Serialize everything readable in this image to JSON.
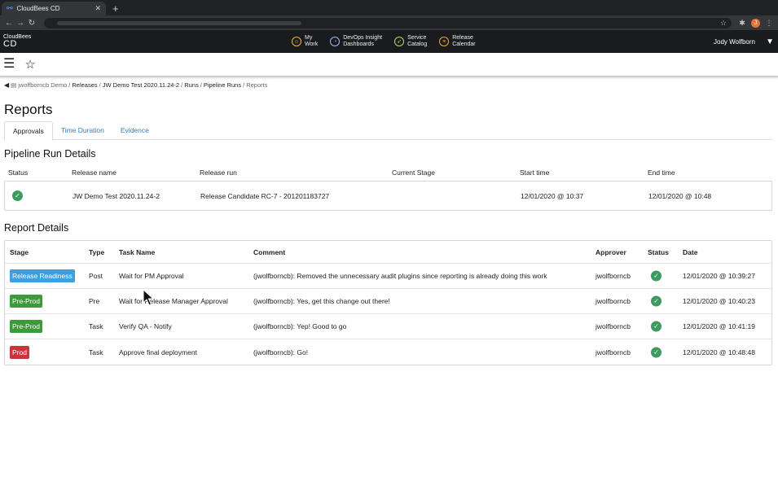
{
  "browser": {
    "tab_title": "CloudBees CD",
    "tab_close": "✕",
    "new_tab": "+",
    "avatar_letter": "J"
  },
  "app": {
    "brand_top": "CloudBees",
    "brand_bottom": "CD",
    "nav": [
      {
        "line1": "My",
        "line2": "Work"
      },
      {
        "line1": "DevOps Insight",
        "line2": "Dashboards"
      },
      {
        "line1": "Service",
        "line2": "Catalog"
      },
      {
        "line1": "Release",
        "line2": "Calendar"
      }
    ],
    "user": "Jody Wolfborn"
  },
  "breadcrumb": {
    "project": "jwolfborncb Demo",
    "releases": "Releases",
    "release": "JW Demo Test 2020.11.24-2",
    "runs": "Runs",
    "pipeline_runs": "Pipeline Runs",
    "current": "Reports"
  },
  "page": {
    "title": "Reports",
    "tabs": [
      "Approvals",
      "Time Duration",
      "Evidence"
    ]
  },
  "pipeline_run": {
    "heading": "Pipeline Run Details",
    "columns": [
      "Status",
      "Release name",
      "Release run",
      "Current Stage",
      "Start time",
      "End time"
    ],
    "row": {
      "release_name": "JW Demo Test 2020.11.24-2",
      "release_run": "Release Candidate RC-7 - 201201183727",
      "current_stage": "",
      "start_time": "12/01/2020 @ 10:37",
      "end_time": "12/01/2020 @ 10:48"
    }
  },
  "report": {
    "heading": "Report Details",
    "columns": [
      "Stage",
      "Type",
      "Task Name",
      "Comment",
      "Approver",
      "Status",
      "Date"
    ],
    "rows": [
      {
        "stage": "Release Readiness",
        "stage_color": "#3f9fdc",
        "type": "Post",
        "task": "Wait for PM Approval",
        "comment": "(jwolfborncb): Removed the unnecessary audit plugins since reporting is already doing this work",
        "approver": "jwolfborncb",
        "date": "12/01/2020 @ 10:39:27"
      },
      {
        "stage": "Pre-Prod",
        "stage_color": "#3c9a3c",
        "type": "Pre",
        "task": "Wait for Release Manager Approval",
        "comment": "(jwolfborncb): Yes, get this change out there!",
        "approver": "jwolfborncb",
        "date": "12/01/2020 @ 10:40:23"
      },
      {
        "stage": "Pre-Prod",
        "stage_color": "#3c9a3c",
        "type": "Task",
        "task": "Verify QA - Notify",
        "comment": "(jwolfborncb): Yep! Good to go",
        "approver": "jwolfborncb",
        "date": "12/01/2020 @ 10:41:19"
      },
      {
        "stage": "Prod",
        "stage_color": "#c8353b",
        "type": "Task",
        "task": "Approve final deployment",
        "comment": "(jwolfborncb): Go!",
        "approver": "jwolfborncb",
        "date": "12/01/2020 @ 10:48:48"
      }
    ]
  }
}
